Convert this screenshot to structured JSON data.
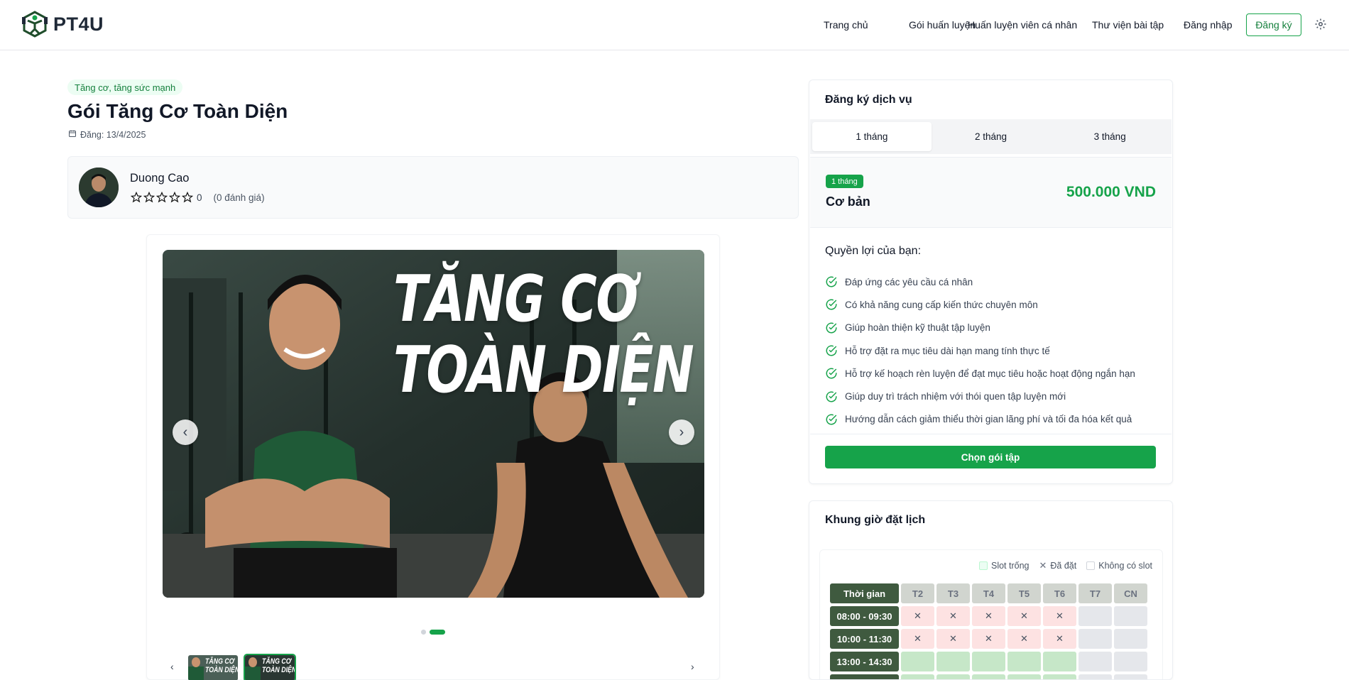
{
  "header": {
    "brand": "PT4U",
    "nav": [
      "Trang chủ",
      "Gói huấn luyện",
      "Huấn luyện viên cá nhân",
      "Thư viện bài tập",
      "Đăng nhập"
    ],
    "register_label": "Đăng ký"
  },
  "package": {
    "category": "Tăng cơ, tăng sức mạnh",
    "title": "Gói Tăng Cơ Toàn Diện",
    "posted": "Đăng: 13/4/2025"
  },
  "trainer": {
    "name": "Duong Cao",
    "rating": "0",
    "reviews": "(0 đánh giá)"
  },
  "gallery": {
    "hero_line1": "TĂNG CƠ",
    "hero_line2": "TOÀN DIỆN",
    "active_slide": 2,
    "slide_count": 2,
    "thumb_text1": "TĂNG CƠ",
    "thumb_text2": "TOÀN DIỆN"
  },
  "service": {
    "title": "Đăng ký dịch vụ",
    "tabs": [
      "1 tháng",
      "2 tháng",
      "3 tháng"
    ],
    "plan_badge": "1 tháng",
    "plan_name": "Cơ bản",
    "plan_price": "500.000 VND",
    "benefits_title": "Quyền lợi của bạn:",
    "benefits": [
      "Đáp ứng các yêu cầu cá nhân",
      "Có khả năng cung cấp kiến thức chuyên môn",
      "Giúp hoàn thiện kỹ thuật tập luyện",
      "Hỗ trợ đặt ra mục tiêu dài hạn mang tính thực tế",
      "Hỗ trợ kế hoạch rèn luyện để đạt mục tiêu hoặc hoạt động ngắn hạn",
      "Giúp duy trì trách nhiệm với thói quen tập luyện mới",
      "Hướng dẫn cách giảm thiểu thời gian lãng phí và tối đa hóa kết quả"
    ],
    "choose_label": "Chọn gói tập"
  },
  "schedule": {
    "title": "Khung giờ đặt lịch",
    "legend": [
      "Slot trống",
      "Đã đặt",
      "Không có slot"
    ],
    "time_header": "Thời gian",
    "days": [
      "T2",
      "T3",
      "T4",
      "T5",
      "T6",
      "T7",
      "CN"
    ],
    "rows": [
      {
        "time": "08:00 - 09:30",
        "slots": [
          "booked",
          "booked",
          "booked",
          "booked",
          "booked",
          "na",
          "na"
        ]
      },
      {
        "time": "10:00 - 11:30",
        "slots": [
          "booked",
          "booked",
          "booked",
          "booked",
          "booked",
          "na",
          "na"
        ]
      },
      {
        "time": "13:00 - 14:30",
        "slots": [
          "free",
          "free",
          "free",
          "free",
          "free",
          "na",
          "na"
        ]
      },
      {
        "time": "",
        "slots": [
          "free",
          "free",
          "free",
          "free",
          "free",
          "na",
          "na"
        ]
      }
    ]
  },
  "colors": {
    "accent": "#16a34a",
    "time_cell": "#3f5a3f",
    "booked": "#fde2e2",
    "free": "#c6e7c8"
  }
}
